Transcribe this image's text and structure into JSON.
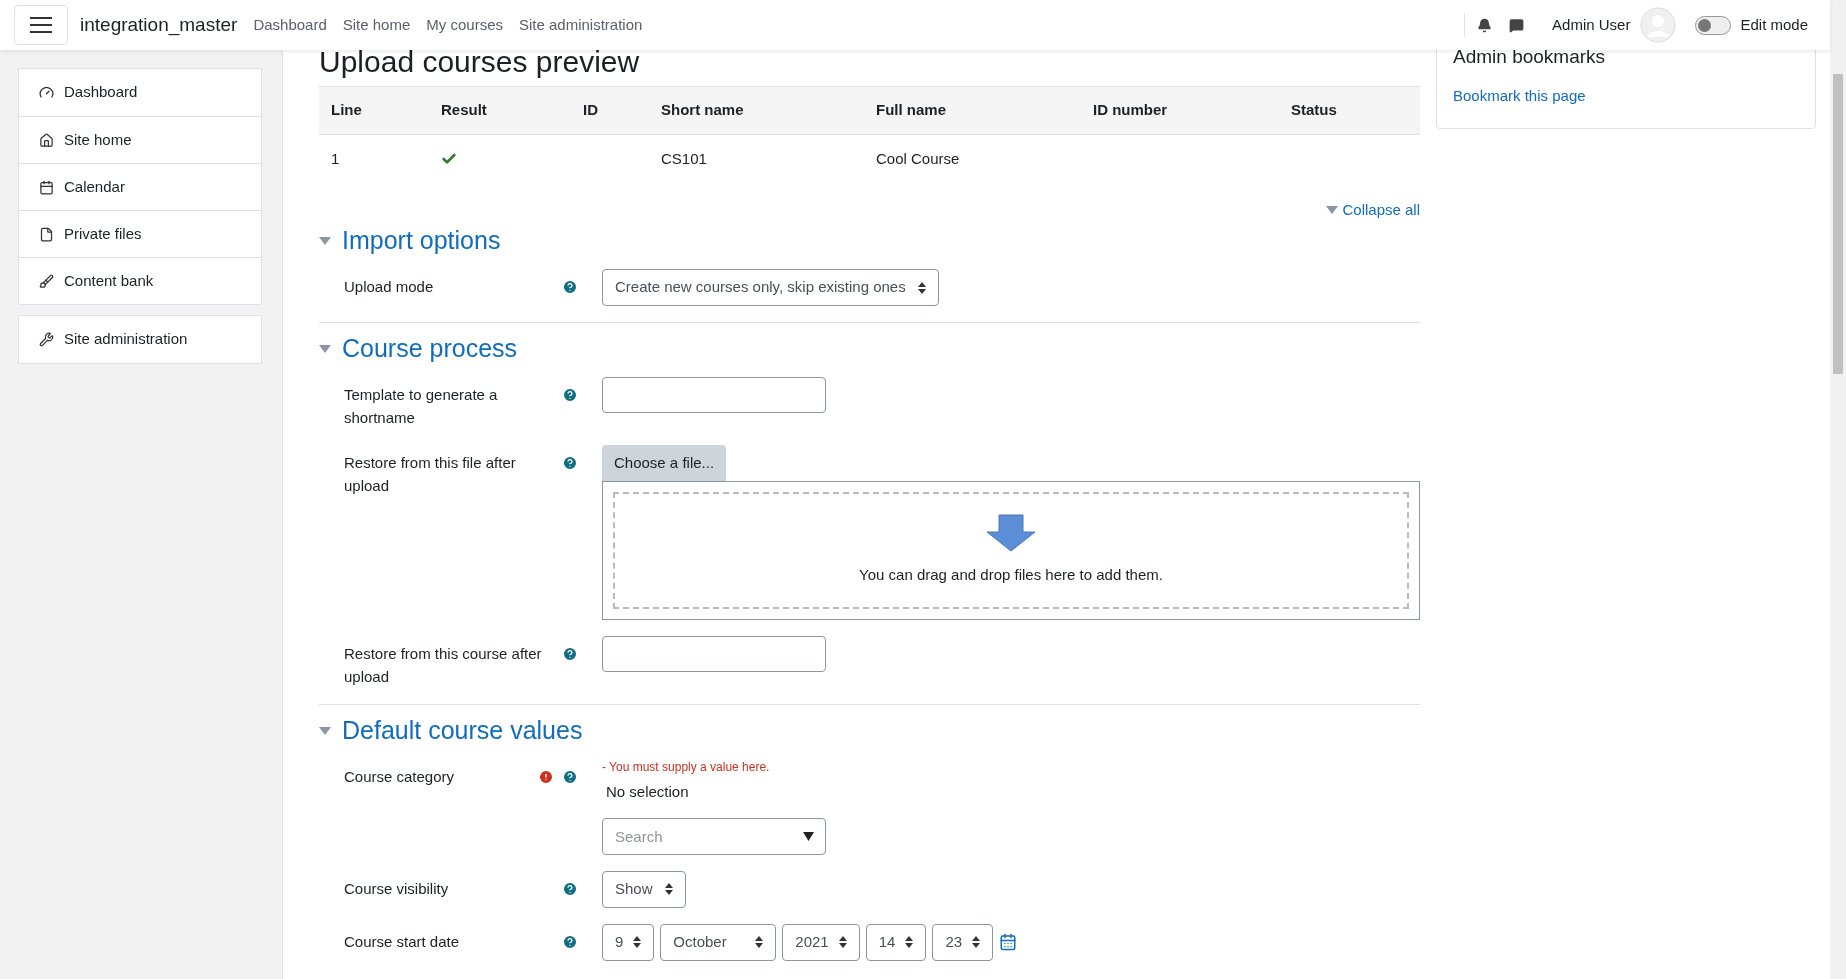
{
  "navbar": {
    "brand": "integration_master",
    "links": [
      "Dashboard",
      "Site home",
      "My courses",
      "Site administration"
    ],
    "user": "Admin User",
    "edit_mode": {
      "label": "Edit mode",
      "on": false
    }
  },
  "sidebar": {
    "groups": [
      [
        {
          "label": "Dashboard"
        },
        {
          "label": "Site home"
        },
        {
          "label": "Calendar"
        },
        {
          "label": "Private files"
        },
        {
          "label": "Content bank"
        }
      ],
      [
        {
          "label": "Site administration"
        }
      ]
    ]
  },
  "page_title": "Upload courses preview",
  "table": {
    "columns": [
      "Line",
      "Result",
      "ID",
      "Short name",
      "Full name",
      "ID number",
      "Status"
    ],
    "rows": [
      {
        "line": "1",
        "result_ok": true,
        "id": "",
        "short_name": "CS101",
        "full_name": "Cool Course",
        "id_number": "",
        "status": ""
      }
    ]
  },
  "collapse_all": "Collapse all",
  "sections": [
    {
      "title": "Import options",
      "expanded": true,
      "rows": [
        {
          "kind": "select",
          "label": "Upload mode",
          "value": "Create new courses only, skip existing ones"
        }
      ]
    },
    {
      "title": "Course process",
      "expanded": true,
      "rows": [
        {
          "kind": "text",
          "label": "Template to generate a shortname"
        },
        {
          "kind": "file",
          "label": "Restore from this file after upload",
          "button": "Choose a file...",
          "drop_hint": "You can drag and drop files here to add them."
        },
        {
          "kind": "text",
          "label": "Restore from this course after upload"
        }
      ]
    },
    {
      "title": "Default course values",
      "expanded": true,
      "rows": [
        {
          "kind": "autocomplete",
          "label": "Course category",
          "error": "- You must supply a value here.",
          "selection": "No selection",
          "placeholder": "Search"
        },
        {
          "kind": "select",
          "label": "Course visibility",
          "value": "Show"
        },
        {
          "kind": "date",
          "label": "Course start date",
          "parts": [
            "9",
            "October",
            "2021",
            "14",
            "23"
          ]
        }
      ]
    }
  ],
  "block": {
    "title": "Admin bookmarks",
    "link": "Bookmark this page"
  }
}
